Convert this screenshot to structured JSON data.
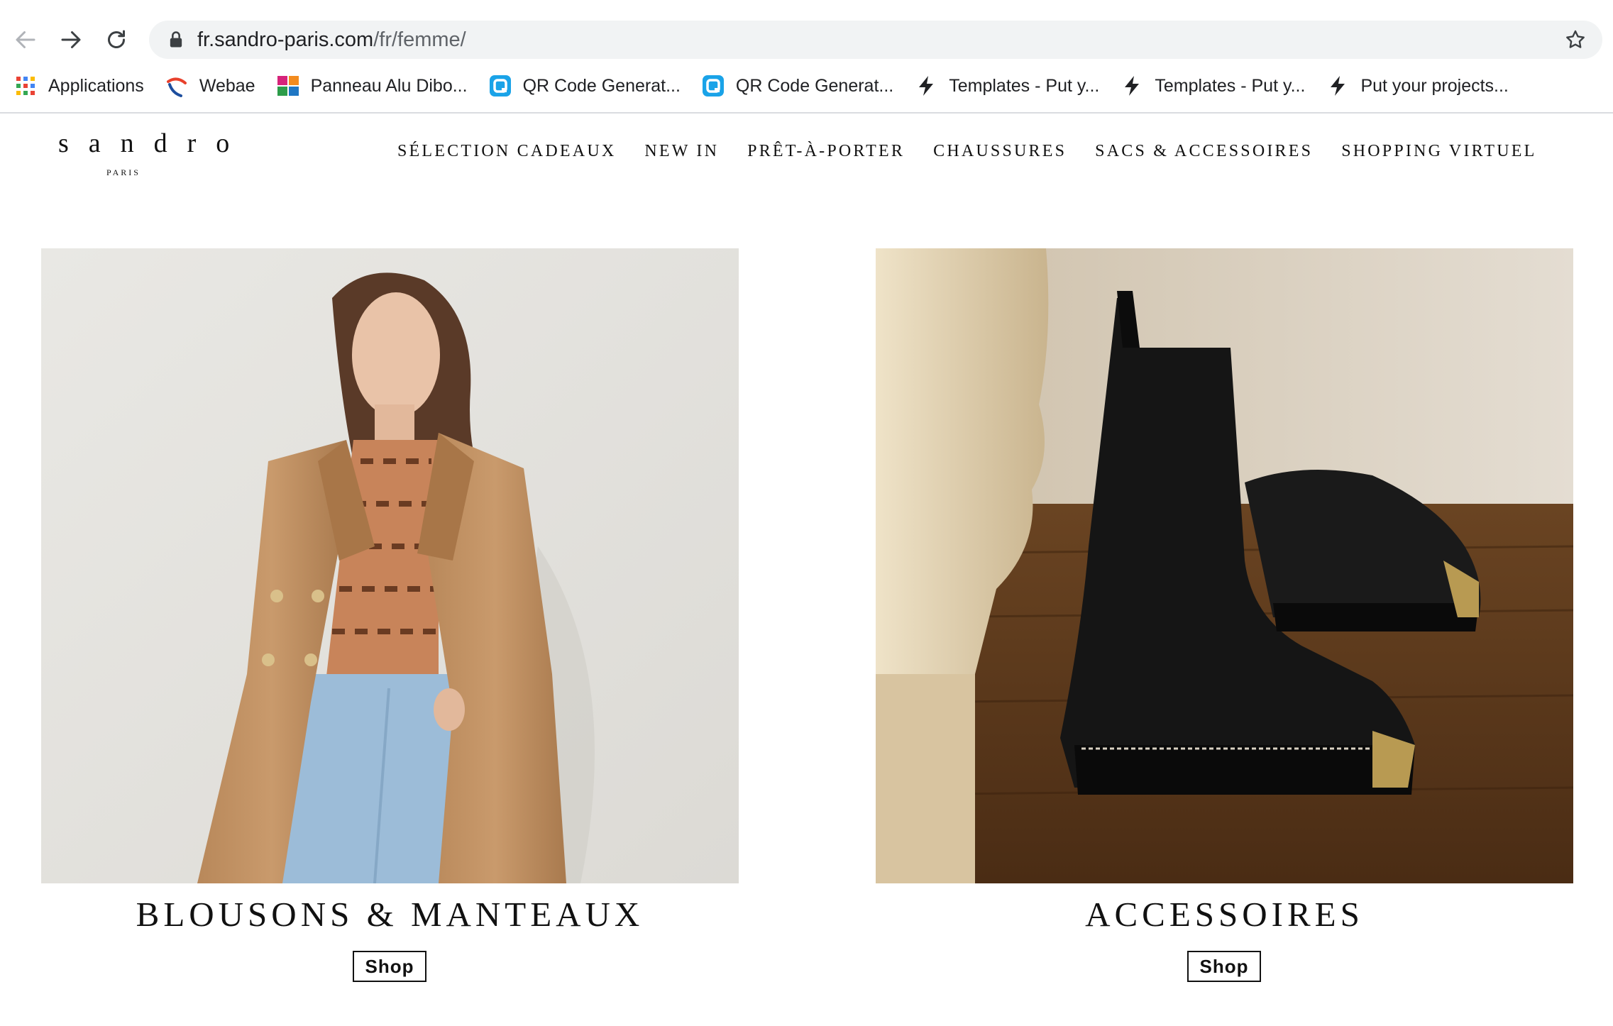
{
  "browser": {
    "url_domain": "fr.sandro-paris.com",
    "url_path": "/fr/femme/",
    "bookmarks": [
      {
        "label": "Applications",
        "icon": "apps-grid-icon"
      },
      {
        "label": "Webae",
        "icon": "webae-icon"
      },
      {
        "label": "Panneau Alu Dibo...",
        "icon": "boutipub-icon"
      },
      {
        "label": "QR Code Generat...",
        "icon": "qr-code-icon"
      },
      {
        "label": "QR Code Generat...",
        "icon": "qr-code-icon"
      },
      {
        "label": "Templates - Put y...",
        "icon": "bolt-icon"
      },
      {
        "label": "Templates - Put y...",
        "icon": "bolt-icon"
      },
      {
        "label": "Put your projects...",
        "icon": "bolt-icon"
      }
    ]
  },
  "site": {
    "logo": "sandro",
    "logo_sub": "PARIS",
    "menu": [
      "SÉLECTION CADEAUX",
      "NEW IN",
      "PRÊT-À-PORTER",
      "CHAUSSURES",
      "SACS & ACCESSOIRES",
      "SHOPPING VIRTUEL"
    ]
  },
  "tiles": [
    {
      "title": "BLOUSONS & MANTEAUX",
      "button": "Shop",
      "image": "woman-in-camel-coat-photo"
    },
    {
      "title": "ACCESSOIRES",
      "button": "Shop",
      "image": "black-chelsea-boots-photo"
    }
  ],
  "colors": {
    "chrome_bg": "#ffffff",
    "omnibox_bg": "#f1f3f4",
    "qr_icon": "#1aa3e8",
    "text": "#111111"
  }
}
